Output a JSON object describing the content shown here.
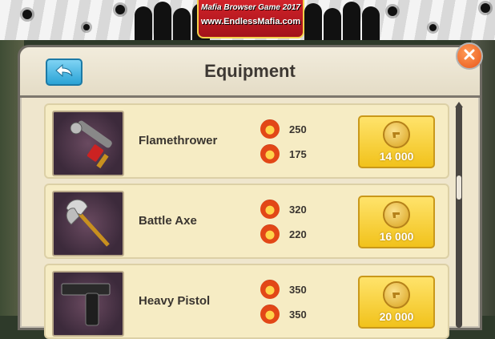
{
  "banner": {
    "line1": "Mafia Browser Game 2017",
    "line2": "www.EndlessMafia.com"
  },
  "dialog": {
    "title": "Equipment",
    "back_icon": "back-arrow-icon",
    "close_icon": "close-x-icon"
  },
  "items": [
    {
      "name": "Flamethrower",
      "attack": "250",
      "defense": "175",
      "price": "14 000",
      "icon": "flamethrower-icon"
    },
    {
      "name": "Battle Axe",
      "attack": "320",
      "defense": "220",
      "price": "16 000",
      "icon": "battle-axe-icon"
    },
    {
      "name": "Heavy Pistol",
      "attack": "350",
      "defense": "350",
      "price": "20 000",
      "icon": "heavy-pistol-icon"
    }
  ],
  "colors": {
    "accent_gold": "#f1c21b",
    "back_blue": "#2aa3d6",
    "close_orange": "#e8561a"
  }
}
